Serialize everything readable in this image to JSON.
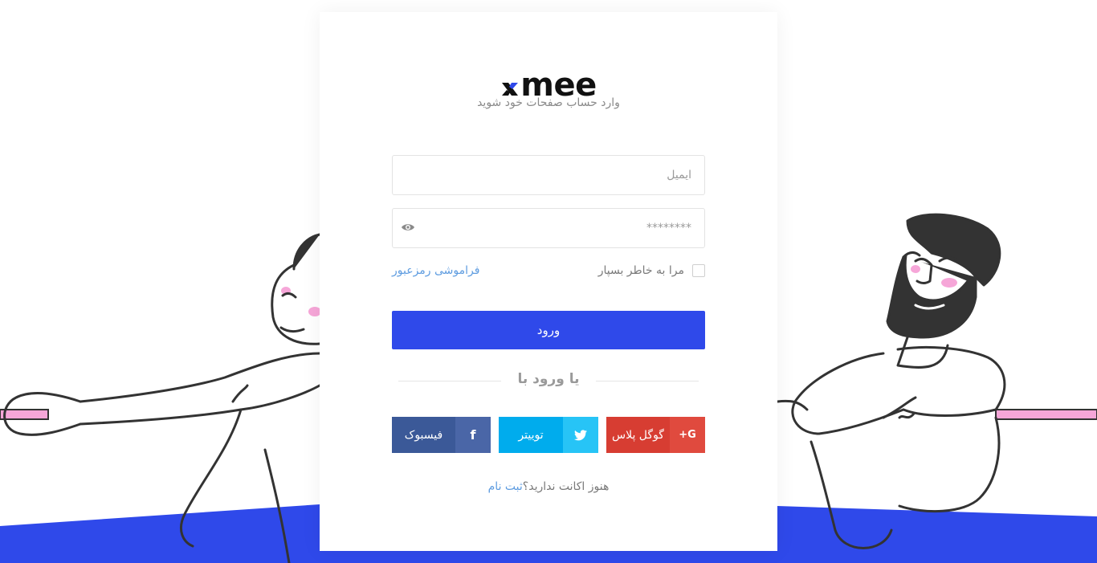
{
  "brand": {
    "logo_text": "mee"
  },
  "subtitle": "وارد حساب صفحات خود شوید",
  "form": {
    "email_placeholder": "ایمیل",
    "password_placeholder": "********",
    "remember_label": "مرا به خاطر بسپار",
    "forgot_label": "فراموشی رمزعبور",
    "login_label": "ورود"
  },
  "divider_text": "یا ورود با",
  "social": {
    "google": {
      "label": "گوگل پلاس",
      "icon": "G+",
      "color": "#d73d32",
      "icon_color": "#e04a3e"
    },
    "twitter": {
      "label": "توییتر",
      "icon": "twitter-bird",
      "color": "#00aced",
      "icon_color": "#27c4f6"
    },
    "facebook": {
      "label": "فیسبوک",
      "icon": "f",
      "color": "#3b5998",
      "icon_color": "#4a66a7"
    }
  },
  "signup": {
    "prompt": "هنوز اکانت ندارید؟",
    "link": "ثبت نام"
  },
  "colors": {
    "primary": "#2f49ea",
    "link": "#5e9ce0",
    "ground": "#2f49ea",
    "rope": "#f6a6d8"
  }
}
